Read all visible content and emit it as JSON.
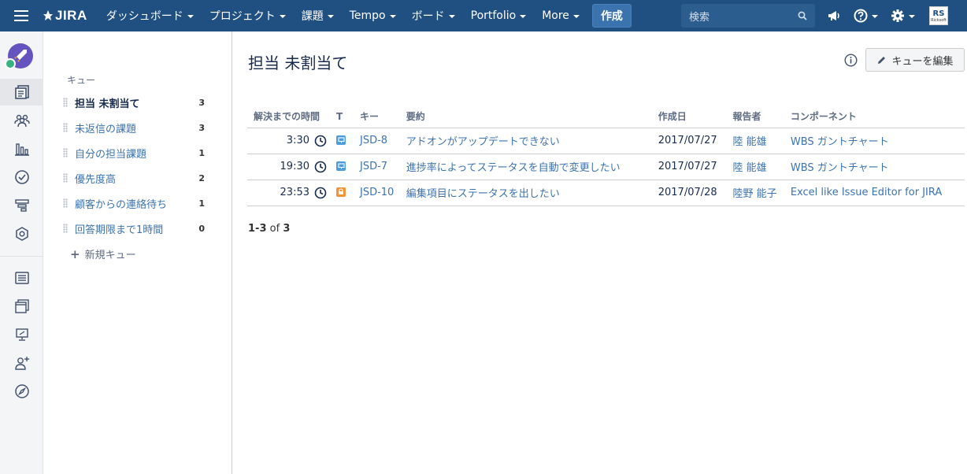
{
  "nav": {
    "logo_text": "JIRA",
    "items": [
      {
        "label": "ダッシュボード"
      },
      {
        "label": "プロジェクト"
      },
      {
        "label": "課題"
      },
      {
        "label": "Tempo"
      },
      {
        "label": "ボード"
      },
      {
        "label": "Portfolio"
      },
      {
        "label": "More"
      }
    ],
    "create_label": "作成",
    "search_placeholder": "検索",
    "avatar_top": "RS",
    "avatar_sub": "Ricksoft"
  },
  "colors": {
    "nav_bg": "#205081",
    "link": "#3b73af",
    "service_request": "#4a9ee0",
    "access_request": "#f79232"
  },
  "sidebar": {
    "header": "キュー",
    "queues": [
      {
        "label": "担当 未割当て",
        "count": "3",
        "active": true
      },
      {
        "label": "未返信の課題",
        "count": "3"
      },
      {
        "label": "自分の担当課題",
        "count": "1"
      },
      {
        "label": "優先度高",
        "count": "2"
      },
      {
        "label": "顧客からの連絡待ち",
        "count": "1"
      },
      {
        "label": "回答期限まで1時間",
        "count": "0"
      }
    ],
    "new_queue": "新規キュー"
  },
  "main": {
    "title": "担当 未割当て",
    "edit_button": "キューを編集",
    "columns": [
      "解決までの時間",
      "T",
      "キー",
      "要約",
      "作成日",
      "報告者",
      "コンポーネント"
    ],
    "rows": [
      {
        "time": "3:30",
        "type_icon": "monitor-icon",
        "key": "JSD-8",
        "summary": "アドオンがアップデートできない",
        "created": "2017/07/27",
        "reporter": "陸 能雄",
        "component": "WBS ガントチャート"
      },
      {
        "time": "19:30",
        "type_icon": "monitor-icon",
        "key": "JSD-7",
        "summary": "進捗率によってステータスを自動で変更したい",
        "created": "2017/07/27",
        "reporter": "陸 能雄",
        "component": "WBS ガントチャート"
      },
      {
        "time": "23:53",
        "type_icon": "lock-icon",
        "key": "JSD-10",
        "summary": "編集項目にステータスを出したい",
        "created": "2017/07/28",
        "reporter": "陸野 能子",
        "component": "Excel like Issue Editor for JIRA"
      }
    ],
    "paging": {
      "range": "1-3",
      "of": "of",
      "total": "3"
    }
  }
}
